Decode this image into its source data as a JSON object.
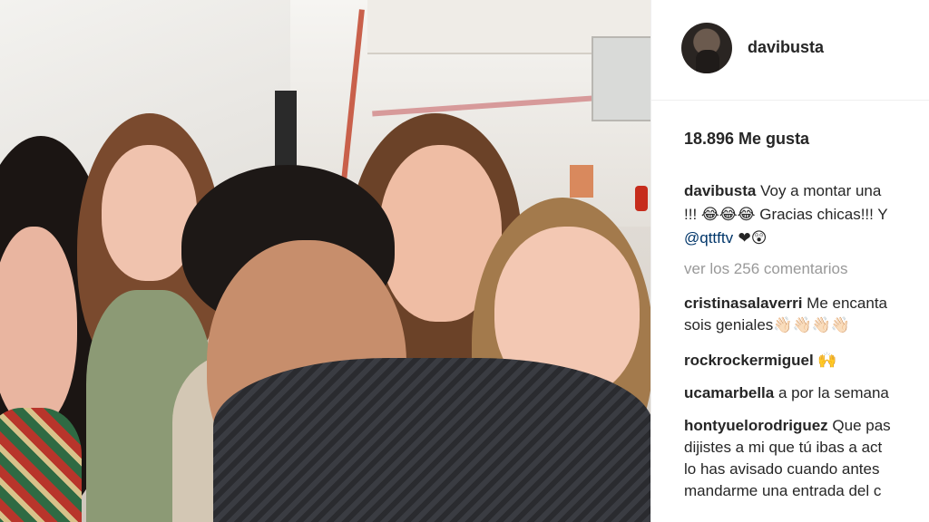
{
  "post": {
    "username": "davibusta",
    "likes": "18.896 Me gusta",
    "caption": {
      "user": "davibusta",
      "line1": "Voy a montar una",
      "line2_start": "!!! ",
      "line2_emoji": "😂😂😂",
      "line2_text": " Gracias chicas!!! Y",
      "line3_mention": "@qttftv",
      "line3_emoji": " ❤😲"
    },
    "view_comments": "ver los 256 comentarios",
    "comments": [
      {
        "user": "cristinasalaverri",
        "line1": "Me encanta",
        "line2": "sois geniales",
        "emoji": "👋🏻👋🏻👋🏻👋🏻"
      },
      {
        "user": "rockrockermiguel",
        "line1": "",
        "emoji": "🙌"
      },
      {
        "user": "ucamarbella",
        "line1": "a por la semana"
      },
      {
        "user": "hontyuelorodriguez",
        "line1": "Que pas",
        "line2": "dijistes a mi que tú ibas a act",
        "line3": "lo has avisado cuando antes",
        "line4": "mandarme una entrada del c"
      }
    ]
  },
  "colors": {
    "text": "#262626",
    "muted": "#999999",
    "link": "#003569",
    "border": "#efefef"
  }
}
